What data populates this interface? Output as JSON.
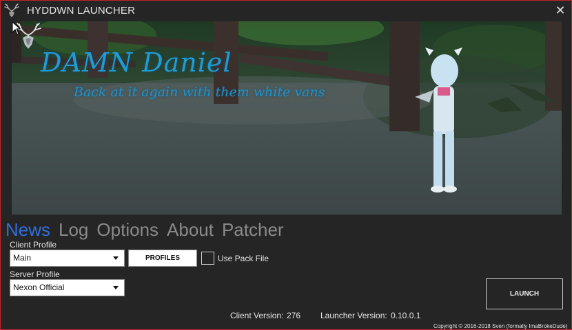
{
  "window": {
    "title": "HYDDWN LAUNCHER",
    "border_color": "#c0242a",
    "icons": {
      "app": "deer-antler-icon",
      "close": "close-icon"
    },
    "close_glyph": "✕"
  },
  "banner": {
    "title": "DAMN Daniel",
    "subtitle": "Back at it again with them white vans",
    "text_color": "#1f9cd6",
    "logo_icon": "deer-antler-icon"
  },
  "tabs": [
    {
      "label": "News",
      "active": true
    },
    {
      "label": "Log",
      "active": false
    },
    {
      "label": "Options",
      "active": false
    },
    {
      "label": "About",
      "active": false
    },
    {
      "label": "Patcher",
      "active": false
    }
  ],
  "accent_color": "#2f6fe0",
  "client_profile": {
    "label": "Client Profile",
    "selected": "Main",
    "profiles_button": "PROFILES",
    "use_pack_file_label": "Use Pack File",
    "use_pack_file_checked": false
  },
  "server_profile": {
    "label": "Server Profile",
    "selected": "Nexon Official"
  },
  "launch_button": "LAUNCH",
  "versions": {
    "client_label": "Client Version:",
    "client_value": "276",
    "launcher_label": "Launcher Version:",
    "launcher_value": "0.10.0.1"
  },
  "copyright": "Copyright © 2016-2018 Sven (formally ImaBrokeDude)"
}
